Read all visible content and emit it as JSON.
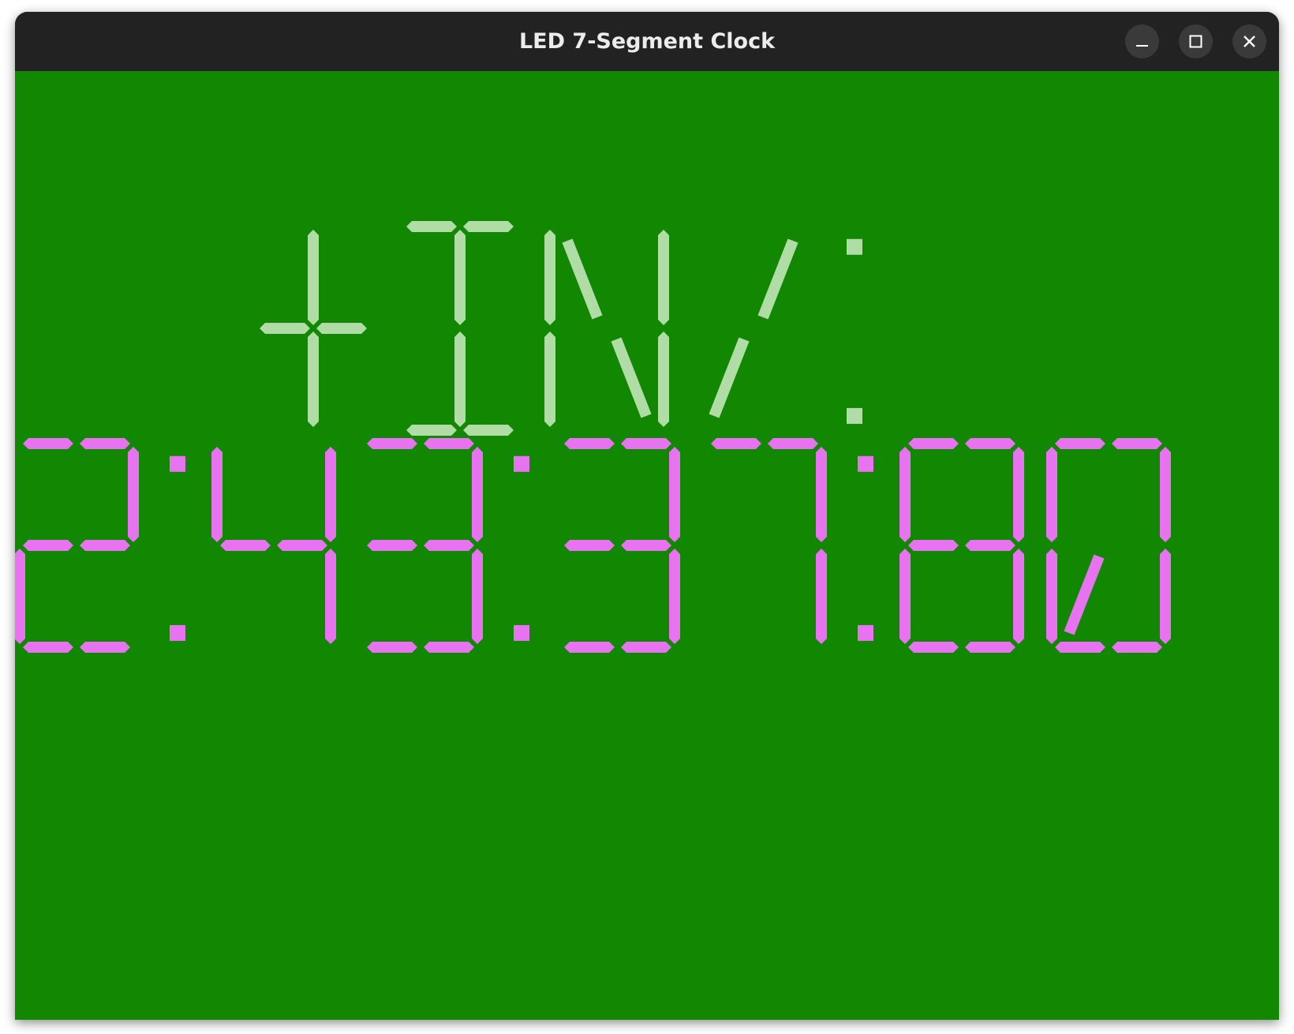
{
  "window": {
    "title": "LED 7-Segment Clock"
  },
  "controls": {
    "minimize_icon": "minimize-icon",
    "maximize_icon": "maximize-icon",
    "close_icon": "close-icon"
  },
  "display": {
    "background_color": "#128702",
    "top_line": {
      "text": "+IN/:",
      "color": "#b0dca6"
    },
    "clock_line": {
      "text": "2:43:37:80",
      "color": "#e873f0"
    }
  }
}
